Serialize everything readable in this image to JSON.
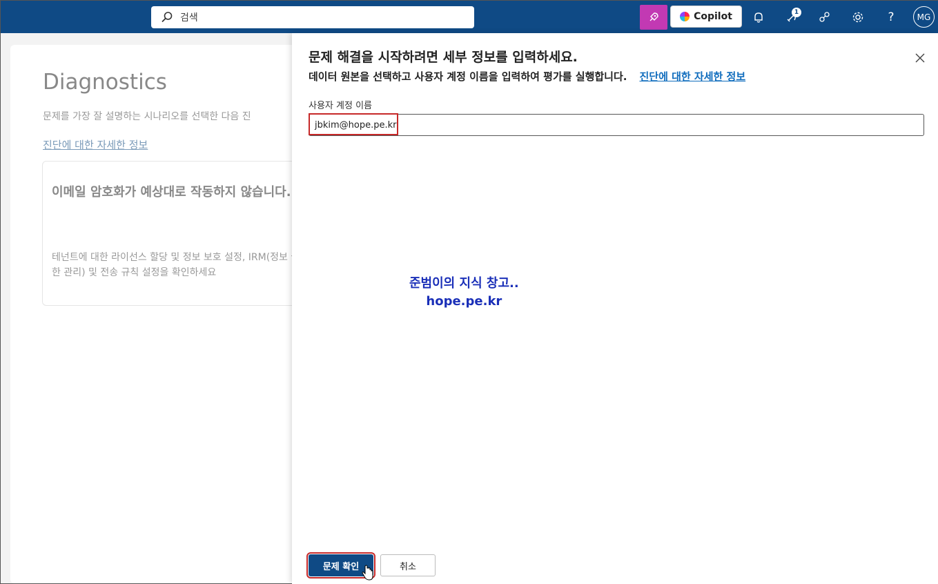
{
  "topbar": {
    "search_placeholder": "검색",
    "copilot_label": "Copilot",
    "notification_count": "1",
    "avatar_initials": "MG"
  },
  "background": {
    "title": "Diagnostics",
    "description": "문제를 가장 잘 설명하는 시나리오를 선택한 다음 진",
    "link": "진단에 대한 자세한 정보",
    "scenario_title": "이메일 암호화가 예상대로 작동하지 않습니다.",
    "scenario_desc": "테넌트에 대한 라이선스 할당 및 정보 보호 설정, IRM(정보 권한 관리) 및 전송 규칙 설정을 확인하세요"
  },
  "panel": {
    "title": "문제 해결을 시작하려면 세부 정보를 입력하세요.",
    "subtitle": "데이터 원본을 선택하고 사용자 계정 이름을 입력하여 평가를 실행합니다.",
    "subtitle_link": "진단에 대한 자세한 정보",
    "field_label": "사용자 계정 이름",
    "field_value": "jbkim@hope.pe.kr",
    "primary_button": "문제 확인",
    "secondary_button": "취소"
  },
  "watermark": {
    "line1": "준범이의 지식 창고..",
    "line2": "hope.pe.kr"
  },
  "colors": {
    "topbar": "#0f4a85",
    "pin_button": "#c239b3",
    "highlight": "#c62828",
    "link": "#0f6cbd"
  }
}
